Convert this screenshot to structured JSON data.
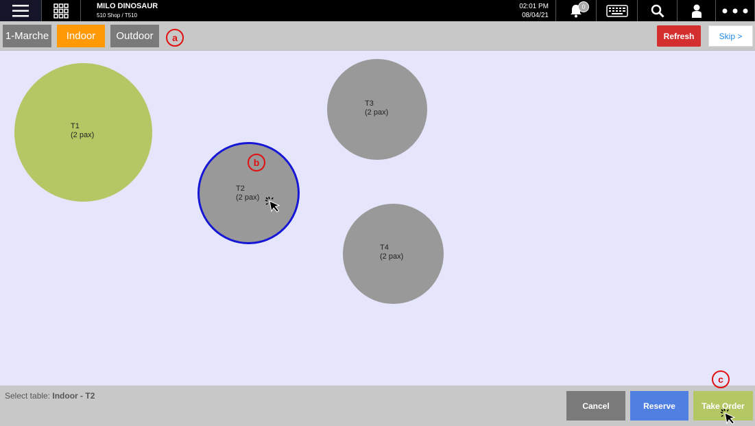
{
  "header": {
    "shop_name": "MILO DINOSAUR",
    "shop_sub": "510 Shop / T510",
    "time": "02:01 PM",
    "date": "08/04/21",
    "notification_count": "0",
    "icons": [
      "hamburger-menu-icon",
      "apps-grid-icon",
      "bell-icon",
      "keyboard-icon",
      "search-icon",
      "user-icon",
      "more-icon"
    ]
  },
  "sections": {
    "tabs": [
      {
        "label": "1-Marche",
        "active": false
      },
      {
        "label": "Indoor",
        "active": true
      },
      {
        "label": "Outdoor",
        "active": false
      }
    ],
    "refresh_label": "Refresh",
    "skip_label": "Skip >"
  },
  "annotations": {
    "a": "a",
    "b": "b",
    "c": "c"
  },
  "tables": [
    {
      "name": "T1",
      "pax": "(2 pax)",
      "status_color": "#b3c865"
    },
    {
      "name": "T2",
      "pax": "(2 pax)",
      "status_color": "#999999",
      "selected": true
    },
    {
      "name": "T3",
      "pax": "(2 pax)",
      "status_color": "#999999"
    },
    {
      "name": "T4",
      "pax": "(2 pax)",
      "status_color": "#999999"
    }
  ],
  "footer": {
    "select_prefix": "Select table: ",
    "select_value": "Indoor - T2",
    "cancel_label": "Cancel",
    "reserve_label": "Reserve",
    "take_order_label": "Take Order"
  },
  "colors": {
    "active_tab": "#ff9a06",
    "refresh": "#d32f2f",
    "reserve": "#4f7fe0",
    "take_order": "#b3c865",
    "selection_ring": "#1616d6",
    "annotation": "#e01010"
  }
}
